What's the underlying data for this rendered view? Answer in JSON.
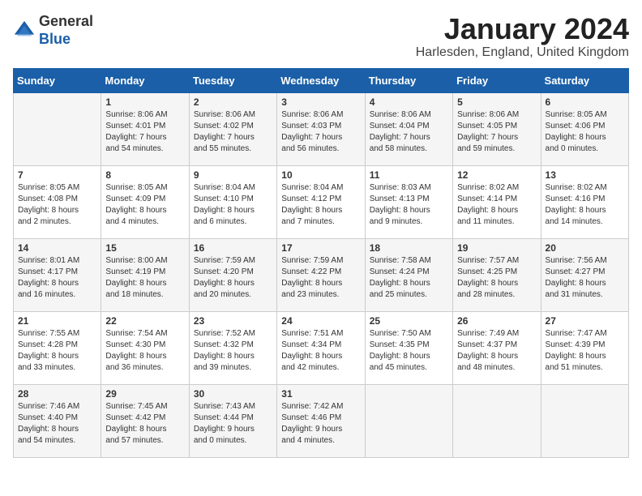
{
  "logo": {
    "general": "General",
    "blue": "Blue"
  },
  "title": "January 2024",
  "subtitle": "Harlesden, England, United Kingdom",
  "days_of_week": [
    "Sunday",
    "Monday",
    "Tuesday",
    "Wednesday",
    "Thursday",
    "Friday",
    "Saturday"
  ],
  "weeks": [
    [
      {
        "day": "",
        "info": ""
      },
      {
        "day": "1",
        "info": "Sunrise: 8:06 AM\nSunset: 4:01 PM\nDaylight: 7 hours\nand 54 minutes."
      },
      {
        "day": "2",
        "info": "Sunrise: 8:06 AM\nSunset: 4:02 PM\nDaylight: 7 hours\nand 55 minutes."
      },
      {
        "day": "3",
        "info": "Sunrise: 8:06 AM\nSunset: 4:03 PM\nDaylight: 7 hours\nand 56 minutes."
      },
      {
        "day": "4",
        "info": "Sunrise: 8:06 AM\nSunset: 4:04 PM\nDaylight: 7 hours\nand 58 minutes."
      },
      {
        "day": "5",
        "info": "Sunrise: 8:06 AM\nSunset: 4:05 PM\nDaylight: 7 hours\nand 59 minutes."
      },
      {
        "day": "6",
        "info": "Sunrise: 8:05 AM\nSunset: 4:06 PM\nDaylight: 8 hours\nand 0 minutes."
      }
    ],
    [
      {
        "day": "7",
        "info": "Sunrise: 8:05 AM\nSunset: 4:08 PM\nDaylight: 8 hours\nand 2 minutes."
      },
      {
        "day": "8",
        "info": "Sunrise: 8:05 AM\nSunset: 4:09 PM\nDaylight: 8 hours\nand 4 minutes."
      },
      {
        "day": "9",
        "info": "Sunrise: 8:04 AM\nSunset: 4:10 PM\nDaylight: 8 hours\nand 6 minutes."
      },
      {
        "day": "10",
        "info": "Sunrise: 8:04 AM\nSunset: 4:12 PM\nDaylight: 8 hours\nand 7 minutes."
      },
      {
        "day": "11",
        "info": "Sunrise: 8:03 AM\nSunset: 4:13 PM\nDaylight: 8 hours\nand 9 minutes."
      },
      {
        "day": "12",
        "info": "Sunrise: 8:02 AM\nSunset: 4:14 PM\nDaylight: 8 hours\nand 11 minutes."
      },
      {
        "day": "13",
        "info": "Sunrise: 8:02 AM\nSunset: 4:16 PM\nDaylight: 8 hours\nand 14 minutes."
      }
    ],
    [
      {
        "day": "14",
        "info": "Sunrise: 8:01 AM\nSunset: 4:17 PM\nDaylight: 8 hours\nand 16 minutes."
      },
      {
        "day": "15",
        "info": "Sunrise: 8:00 AM\nSunset: 4:19 PM\nDaylight: 8 hours\nand 18 minutes."
      },
      {
        "day": "16",
        "info": "Sunrise: 7:59 AM\nSunset: 4:20 PM\nDaylight: 8 hours\nand 20 minutes."
      },
      {
        "day": "17",
        "info": "Sunrise: 7:59 AM\nSunset: 4:22 PM\nDaylight: 8 hours\nand 23 minutes."
      },
      {
        "day": "18",
        "info": "Sunrise: 7:58 AM\nSunset: 4:24 PM\nDaylight: 8 hours\nand 25 minutes."
      },
      {
        "day": "19",
        "info": "Sunrise: 7:57 AM\nSunset: 4:25 PM\nDaylight: 8 hours\nand 28 minutes."
      },
      {
        "day": "20",
        "info": "Sunrise: 7:56 AM\nSunset: 4:27 PM\nDaylight: 8 hours\nand 31 minutes."
      }
    ],
    [
      {
        "day": "21",
        "info": "Sunrise: 7:55 AM\nSunset: 4:28 PM\nDaylight: 8 hours\nand 33 minutes."
      },
      {
        "day": "22",
        "info": "Sunrise: 7:54 AM\nSunset: 4:30 PM\nDaylight: 8 hours\nand 36 minutes."
      },
      {
        "day": "23",
        "info": "Sunrise: 7:52 AM\nSunset: 4:32 PM\nDaylight: 8 hours\nand 39 minutes."
      },
      {
        "day": "24",
        "info": "Sunrise: 7:51 AM\nSunset: 4:34 PM\nDaylight: 8 hours\nand 42 minutes."
      },
      {
        "day": "25",
        "info": "Sunrise: 7:50 AM\nSunset: 4:35 PM\nDaylight: 8 hours\nand 45 minutes."
      },
      {
        "day": "26",
        "info": "Sunrise: 7:49 AM\nSunset: 4:37 PM\nDaylight: 8 hours\nand 48 minutes."
      },
      {
        "day": "27",
        "info": "Sunrise: 7:47 AM\nSunset: 4:39 PM\nDaylight: 8 hours\nand 51 minutes."
      }
    ],
    [
      {
        "day": "28",
        "info": "Sunrise: 7:46 AM\nSunset: 4:40 PM\nDaylight: 8 hours\nand 54 minutes."
      },
      {
        "day": "29",
        "info": "Sunrise: 7:45 AM\nSunset: 4:42 PM\nDaylight: 8 hours\nand 57 minutes."
      },
      {
        "day": "30",
        "info": "Sunrise: 7:43 AM\nSunset: 4:44 PM\nDaylight: 9 hours\nand 0 minutes."
      },
      {
        "day": "31",
        "info": "Sunrise: 7:42 AM\nSunset: 4:46 PM\nDaylight: 9 hours\nand 4 minutes."
      },
      {
        "day": "",
        "info": ""
      },
      {
        "day": "",
        "info": ""
      },
      {
        "day": "",
        "info": ""
      }
    ]
  ]
}
